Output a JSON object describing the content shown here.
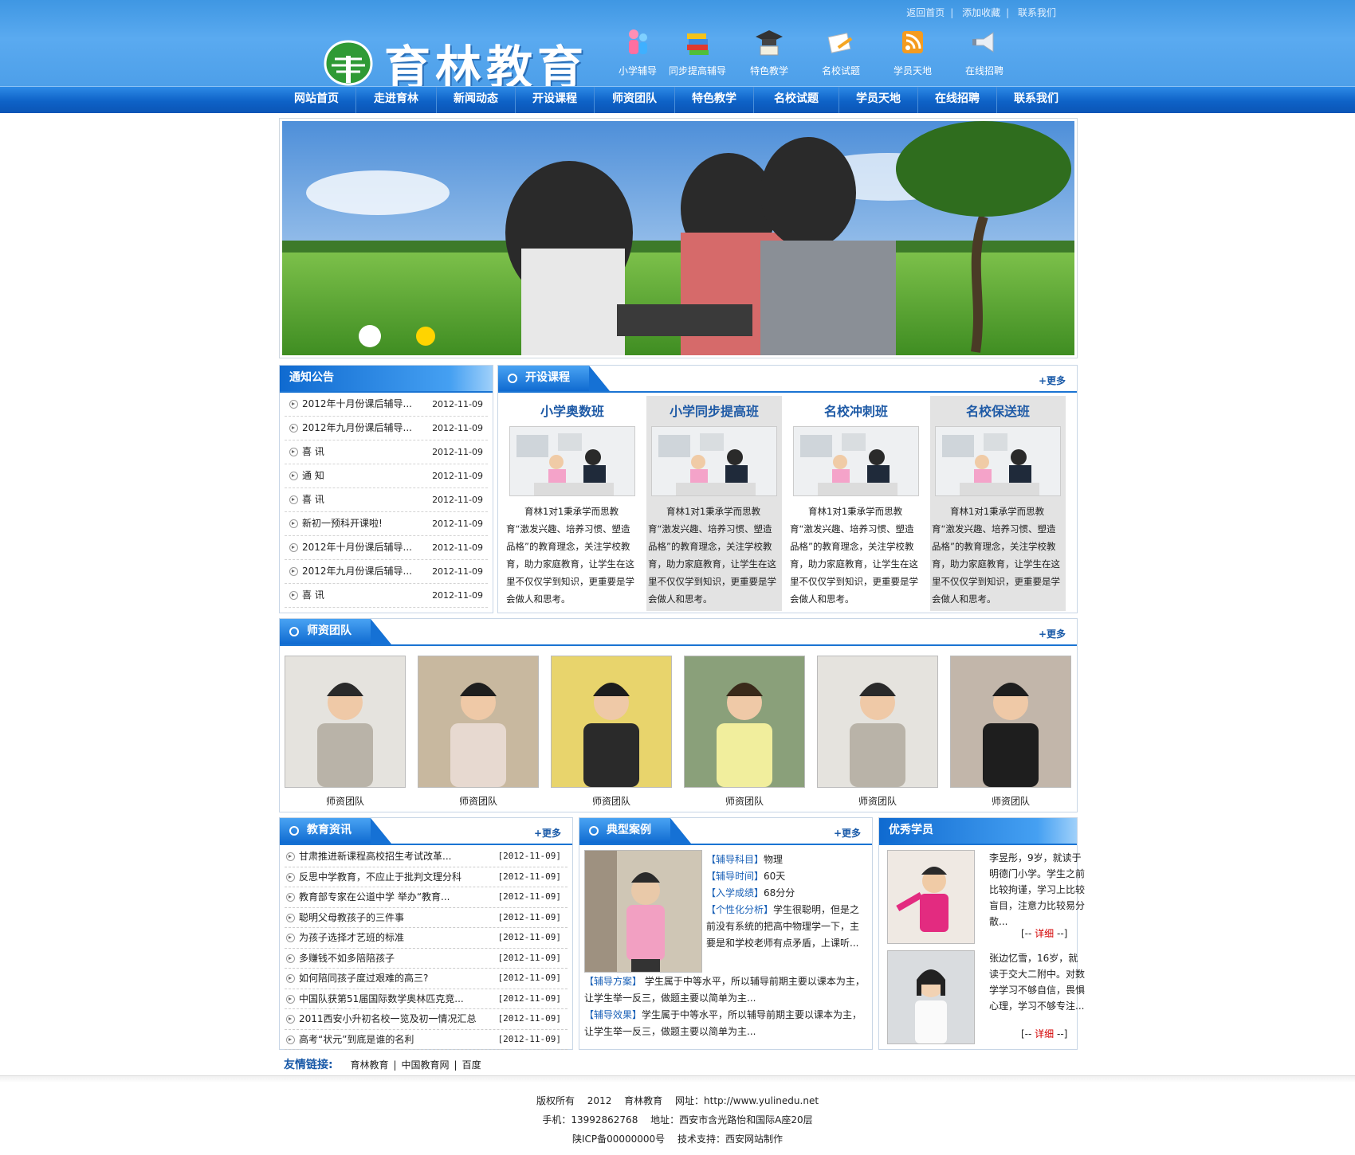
{
  "header": {
    "top_links": [
      "返回首页",
      "添加收藏",
      "联系我们"
    ],
    "logo_text": "育林教育",
    "quick_nav": [
      "小学辅导",
      "同步提高辅导",
      "特色教学",
      "名校试题",
      "学员天地",
      "在线招聘"
    ]
  },
  "main_nav": [
    "网站首页",
    "走进育林",
    "新闻动态",
    "开设课程",
    "师资团队",
    "特色教学",
    "名校试题",
    "学员天地",
    "在线招聘",
    "联系我们"
  ],
  "notice": {
    "title": "通知公告",
    "items": [
      {
        "text": "2012年十月份课后辅导...",
        "date": "2012-11-09"
      },
      {
        "text": "2012年九月份课后辅导...",
        "date": "2012-11-09"
      },
      {
        "text": "喜 讯",
        "date": "2012-11-09"
      },
      {
        "text": "通 知",
        "date": "2012-11-09"
      },
      {
        "text": "喜 讯",
        "date": "2012-11-09"
      },
      {
        "text": "新初一预科开课啦!",
        "date": "2012-11-09"
      },
      {
        "text": "2012年十月份课后辅导...",
        "date": "2012-11-09"
      },
      {
        "text": "2012年九月份课后辅导...",
        "date": "2012-11-09"
      },
      {
        "text": "喜 讯",
        "date": "2012-11-09"
      }
    ]
  },
  "courses": {
    "title": "开设课程",
    "more": "+更多",
    "items": [
      {
        "name": "小学奥数班",
        "desc": "育林1对1秉承学而思教育“激发兴趣、培养习惯、塑造品格”的教育理念，关注学校教育，助力家庭教育，让学生在这里不仅仅学到知识，更重要是学会做人和思考。"
      },
      {
        "name": "小学同步提高班",
        "desc": "育林1对1秉承学而思教育“激发兴趣、培养习惯、塑造品格”的教育理念，关注学校教育，助力家庭教育，让学生在这里不仅仅学到知识，更重要是学会做人和思考。"
      },
      {
        "name": "名校冲刺班",
        "desc": "育林1对1秉承学而思教育“激发兴趣、培养习惯、塑造品格”的教育理念，关注学校教育，助力家庭教育，让学生在这里不仅仅学到知识，更重要是学会做人和思考。"
      },
      {
        "name": "名校保送班",
        "desc": "育林1对1秉承学而思教育“激发兴趣、培养习惯、塑造品格”的教育理念，关注学校教育，助力家庭教育，让学生在这里不仅仅学到知识，更重要是学会做人和思考。"
      }
    ]
  },
  "teachers": {
    "title": "师资团队",
    "more": "+更多",
    "captions": [
      "师资团队",
      "师资团队",
      "师资团队",
      "师资团队",
      "师资团队",
      "师资团队"
    ]
  },
  "edu_news": {
    "title": "教育资讯",
    "more": "+更多",
    "items": [
      {
        "text": "甘肃推进新课程高校招生考试改革...",
        "date": "[2012-11-09]"
      },
      {
        "text": "反思中学教育，不应止于批判文理分科",
        "date": "[2012-11-09]"
      },
      {
        "text": "教育部专家在公道中学 举办“教育...",
        "date": "[2012-11-09]"
      },
      {
        "text": "聪明父母教孩子的三件事",
        "date": "[2012-11-09]"
      },
      {
        "text": "为孩子选择才艺班的标准",
        "date": "[2012-11-09]"
      },
      {
        "text": "多赚钱不如多陪陪孩子",
        "date": "[2012-11-09]"
      },
      {
        "text": "如何陪同孩子度过艰难的高三?",
        "date": "[2012-11-09]"
      },
      {
        "text": "中国队获第51届国际数学奥林匹克竞...",
        "date": "[2012-11-09]"
      },
      {
        "text": "2011西安小升初名校一览及初一情况汇总",
        "date": "[2012-11-09]"
      },
      {
        "text": "高考“状元”到底是谁的名利",
        "date": "[2012-11-09]"
      }
    ]
  },
  "cases": {
    "title": "典型案例",
    "more": "+更多",
    "subject_label": "【辅导科目】",
    "subject": "物理",
    "time_label": "【辅导时间】",
    "time": "60天",
    "score_label": "【入学成绩】",
    "score": "68分分",
    "analysis_label": "【个性化分析】",
    "analysis": "学生很聪明，但是之前没有系统的把高中物理学一下，主要是和学校老师有点矛盾，上课听...",
    "plan_label": "【辅导方案】",
    "plan": " 学生属于中等水平，所以辅导前期主要以课本为主，让学生举一反三，做题主要以简单为主...",
    "effect_label": "【辅导效果】",
    "effect": "学生属于中等水平，所以辅导前期主要以课本为主，让学生举一反三，做题主要以简单为主..."
  },
  "students": {
    "title": "优秀学员",
    "items": [
      {
        "text": "李昱彤，9岁，就读于明德门小学。学生之前比较拘谨，学习上比较盲目，注意力比较易分散...",
        "detail_prefix": "[-- ",
        "detail": "详细",
        "detail_suffix": " --]"
      },
      {
        "text": "张边忆雪，16岁，就读于交大二附中。对数学学习不够自信，畏惧心理，学习不够专注...",
        "detail_prefix": "[-- ",
        "detail": "详细",
        "detail_suffix": " --]"
      }
    ]
  },
  "friend_links": {
    "label": "友情链接:",
    "links": [
      "育林教育",
      "中国教育网",
      "百度"
    ]
  },
  "footer": {
    "line1": [
      "版权所有",
      "2012",
      "育林教育",
      "网址：http://www.yulinedu.net"
    ],
    "line2": [
      "手机：13992862768",
      "地址：西安市含光路怡和国际A座20层"
    ],
    "line3": [
      "陕ICP备00000000号",
      "技术支持：西安网站制作"
    ]
  },
  "colors": {
    "primary": "#1a74d3",
    "header": "#4d9fe9",
    "nav": "#0e62c7",
    "accent_red": "#d40000"
  }
}
